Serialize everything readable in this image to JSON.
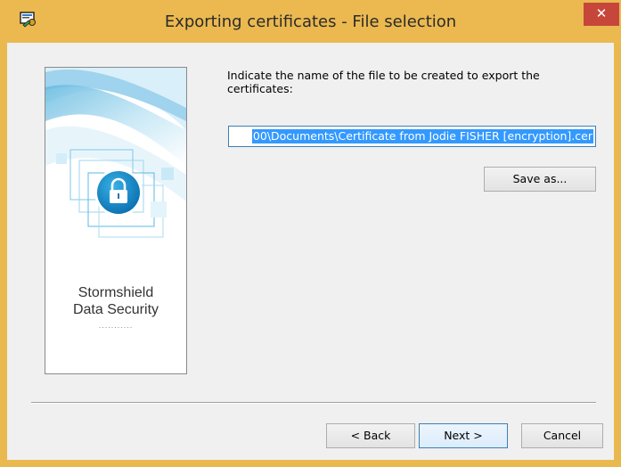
{
  "window": {
    "title": "Exporting certificates - File selection",
    "close_glyph": "✕",
    "accent_color": "#ebb950",
    "close_color": "#c7463a"
  },
  "side_panel": {
    "brand_line1": "Stormshield",
    "brand_line2": "Data Security",
    "dots": "...........",
    "icon": "lock-icon"
  },
  "main": {
    "instruction": "Indicate the name of the file to be created to export the certificates:",
    "filename_value": "00\\Documents\\Certificate from Jodie FISHER [encryption].cer",
    "save_as_label": "Save as..."
  },
  "footer": {
    "back_label": "< Back",
    "next_label": "Next >",
    "cancel_label": "Cancel"
  }
}
